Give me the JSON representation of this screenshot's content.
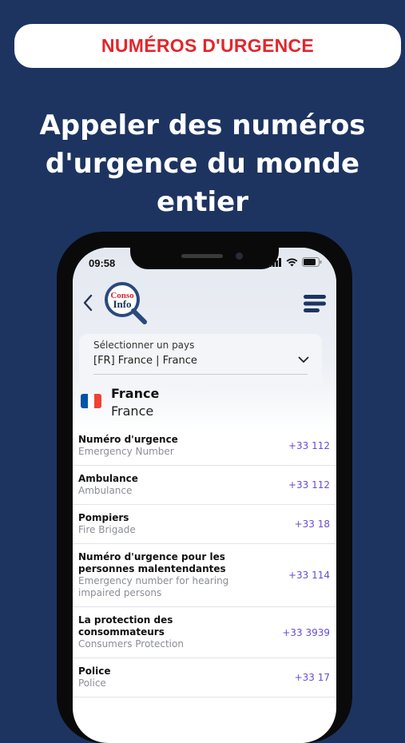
{
  "banner": {
    "label": "NUMÉROS D'URGENCE"
  },
  "headline": {
    "line1": "Appeler des numéros",
    "line2": "d'urgence du monde entier"
  },
  "status_bar": {
    "time": "09:58"
  },
  "app": {
    "logo_text_top": "Conso",
    "logo_text_bottom": "Info",
    "back_icon": "chevron-left-icon",
    "menu_icon": "hamburger-menu-icon"
  },
  "country_select": {
    "label": "Sélectionner un pays",
    "value": "[FR] France | France"
  },
  "country": {
    "name": "France",
    "local_name": "France",
    "flag_colors": [
      "#0055a4",
      "#ffffff",
      "#ef4135"
    ]
  },
  "numbers": [
    {
      "title": "Numéro d'urgence",
      "subtitle": "Emergency Number",
      "number": "+33 112"
    },
    {
      "title": "Ambulance",
      "subtitle": "Ambulance",
      "number": "+33 112"
    },
    {
      "title": "Pompiers",
      "subtitle": "Fire Brigade",
      "number": "+33 18"
    },
    {
      "title": "Numéro d'urgence pour les personnes malentendantes",
      "subtitle": "Emergency number for hearing impaired persons",
      "number": "+33 114"
    },
    {
      "title": "La protection des consommateurs",
      "subtitle": "Consumers Protection",
      "number": "+33 3939"
    },
    {
      "title": "Police",
      "subtitle": "Police",
      "number": "+33 17"
    }
  ],
  "colors": {
    "background": "#1d3461",
    "accent_red": "#e3262b",
    "number": "#6a4ccf"
  }
}
